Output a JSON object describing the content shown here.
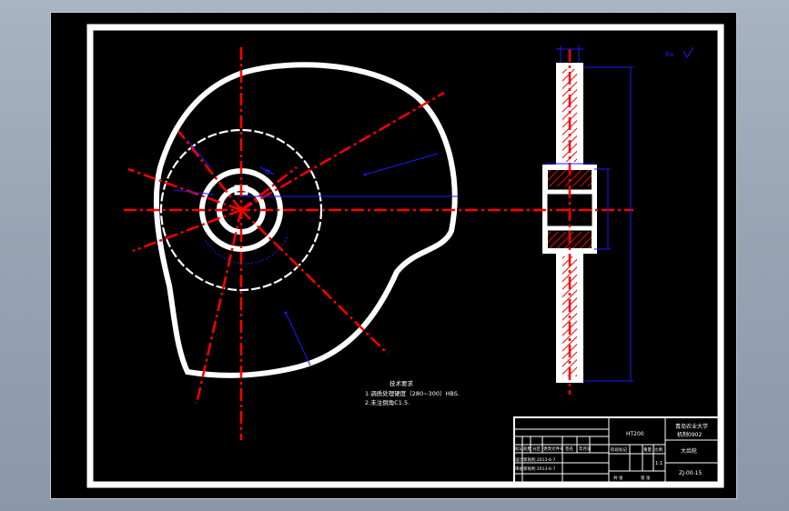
{
  "drawing": {
    "title_block": {
      "school": "青岛农业大学",
      "class_line": "机制0902",
      "part_name": "大齿轮",
      "drawing_no": "ZJ-00-15",
      "material": "HT200",
      "scale": "1:1",
      "row_labels": [
        "标记",
        "处数",
        "分区",
        "更改文件号",
        "签名",
        "年月日"
      ],
      "design_label": "设计",
      "design_value": "郭尚利 2013-6-7",
      "check_label": "审核",
      "check_value": "郭尚利 2013-6-7",
      "stage_label": "阶段标记",
      "weight_label": "重量",
      "scale_label": "比例",
      "bottom_left": "共 张",
      "bottom_right": "第 张"
    },
    "tech_requirements": {
      "heading": "技术要求",
      "lines": [
        "1.调质处理硬度（280~300）HBS.",
        "2.未注倒角C1.5."
      ]
    },
    "roughness_symbol": "Ra",
    "colors": {
      "background": "#000000",
      "outline": "#ffffff",
      "centerline": "#ff0000",
      "dimension": "#1a1aff",
      "frame_outer": "#ffffff"
    }
  }
}
